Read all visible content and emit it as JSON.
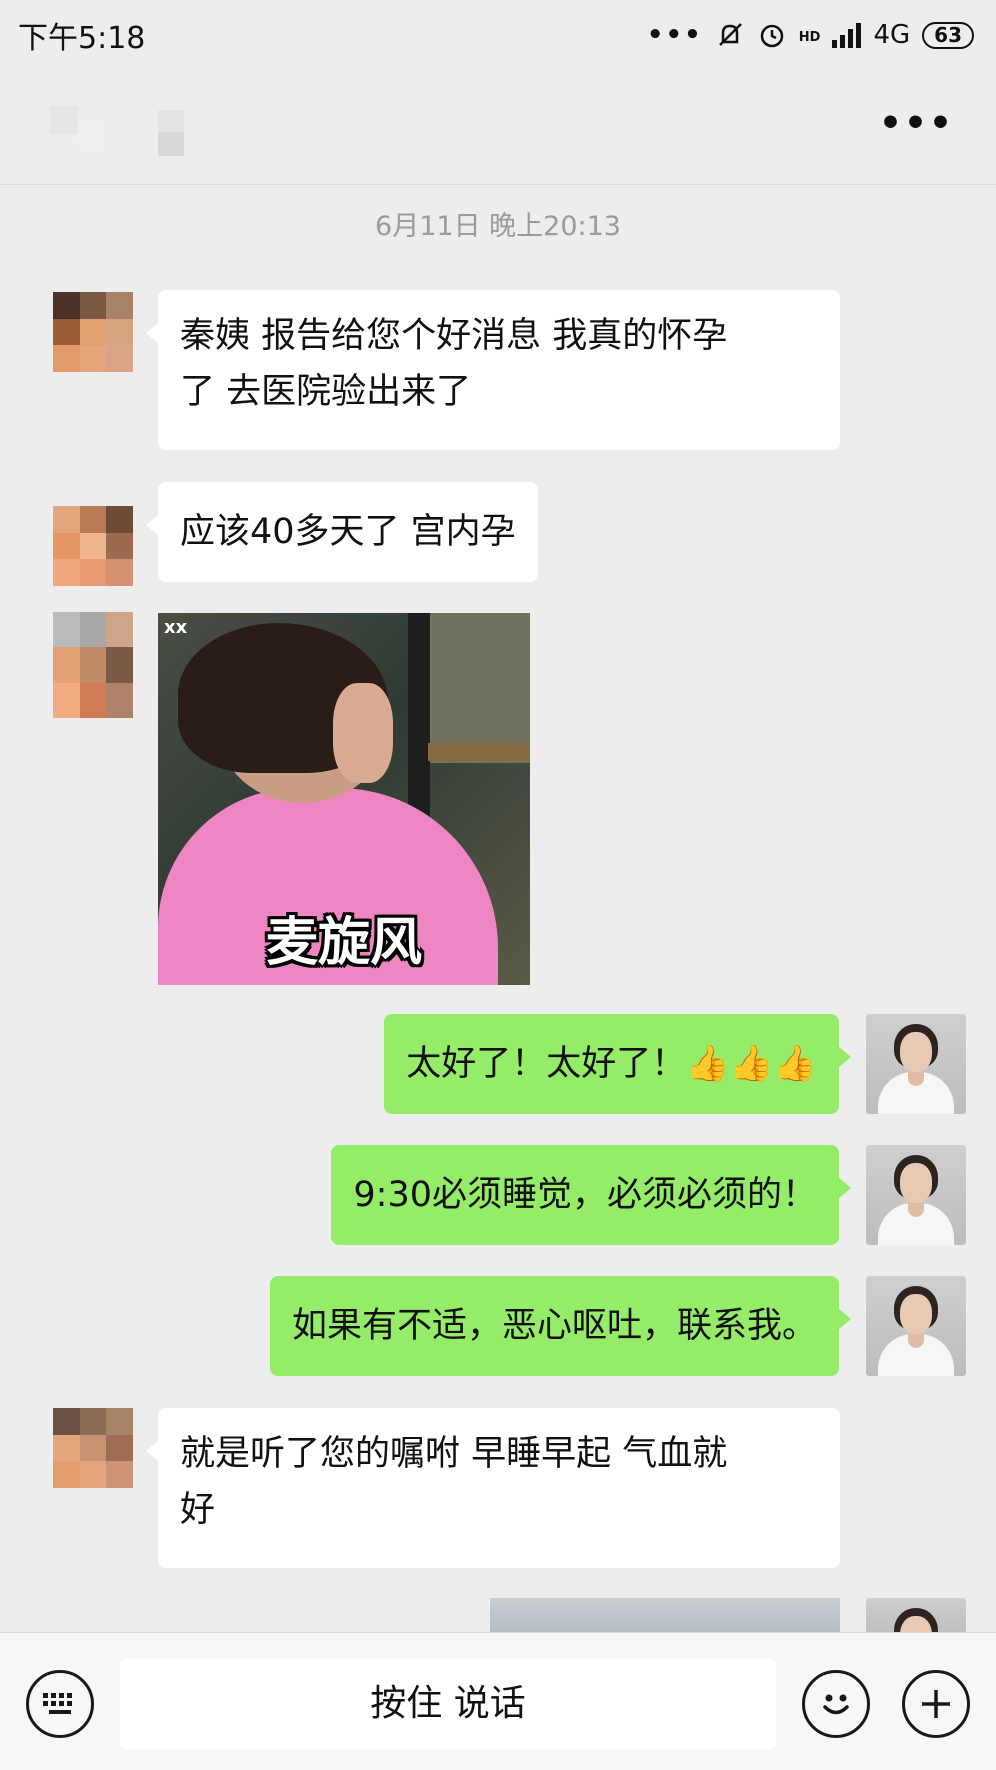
{
  "status_bar": {
    "time": "下午5:18",
    "more": "•••",
    "network": "4G",
    "hd": "HD",
    "battery": "63"
  },
  "header": {
    "more_label": "•••"
  },
  "chat": {
    "timestamp": "6月11日 晚上20:13",
    "msg1": {
      "line1": "秦姨 报告给您个好消息 我真的怀孕",
      "line2": "了 去医院验出来了"
    },
    "msg2": "应该40多天了 宫内孕",
    "sticker": {
      "watermark": "xx",
      "caption": "麦旋风"
    },
    "msg4": {
      "text": "太好了！太好了！",
      "emoji": "👍👍👍"
    },
    "msg5": "9:30必须睡觉，必须必须的！",
    "msg6": "如果有不适，恶心呕吐，联系我。",
    "msg7": {
      "line1": "就是听了您的嘱咐 早睡早起 气血就",
      "line2": "好"
    }
  },
  "input": {
    "voice_label": "按住 说话"
  },
  "colors": {
    "outgoing_bubble": "#95ec69",
    "incoming_bubble": "#ffffff",
    "background": "#ededed"
  }
}
